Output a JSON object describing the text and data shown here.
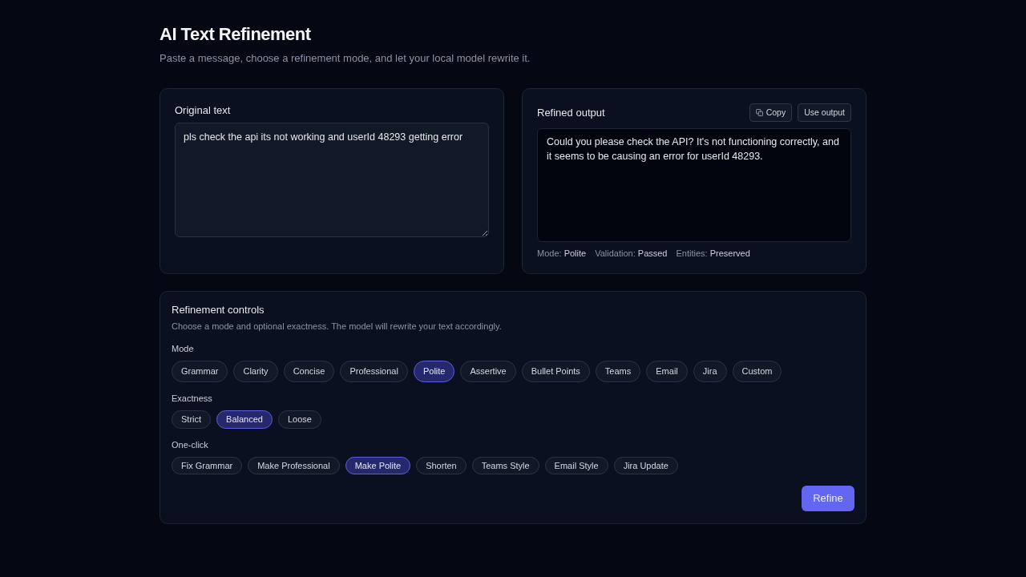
{
  "header": {
    "title": "AI Text Refinement",
    "subtitle": "Paste a message, choose a refinement mode, and let your local model rewrite it."
  },
  "original_panel": {
    "label": "Original text",
    "value": "pls check the api its not working and userId 48293 getting error"
  },
  "output_panel": {
    "label": "Refined output",
    "copy_button": {
      "label": "Copy"
    },
    "use_button": {
      "label": "Use output"
    },
    "text": "Could you please check the API? It's not functioning correctly, and it seems to be causing an error for userId 48293.",
    "meta": [
      {
        "label": "Mode:",
        "value": "Polite"
      },
      {
        "label": "Validation:",
        "value": "Passed"
      },
      {
        "label": "Entities:",
        "value": "Preserved"
      }
    ]
  },
  "controls": {
    "title": "Refinement controls",
    "description": "Choose a mode and optional exactness. The model will rewrite your text accordingly.",
    "mode": {
      "label": "Mode",
      "options": [
        {
          "label": "Grammar",
          "selected": false
        },
        {
          "label": "Clarity",
          "selected": false
        },
        {
          "label": "Concise",
          "selected": false
        },
        {
          "label": "Professional",
          "selected": false
        },
        {
          "label": "Polite",
          "selected": true
        },
        {
          "label": "Assertive",
          "selected": false
        },
        {
          "label": "Bullet Points",
          "selected": false
        },
        {
          "label": "Teams",
          "selected": false
        },
        {
          "label": "Email",
          "selected": false
        },
        {
          "label": "Jira",
          "selected": false
        },
        {
          "label": "Custom",
          "selected": false
        }
      ]
    },
    "exactness": {
      "label": "Exactness",
      "options": [
        {
          "label": "Strict",
          "selected": false
        },
        {
          "label": "Balanced",
          "selected": true
        },
        {
          "label": "Loose",
          "selected": false
        }
      ]
    },
    "one_click": {
      "label": "One-click",
      "options": [
        {
          "label": "Fix Grammar",
          "selected": false
        },
        {
          "label": "Make Professional",
          "selected": false
        },
        {
          "label": "Make Polite",
          "selected": true
        },
        {
          "label": "Shorten",
          "selected": false
        },
        {
          "label": "Teams Style",
          "selected": false
        },
        {
          "label": "Email Style",
          "selected": false
        },
        {
          "label": "Jira Update",
          "selected": false
        }
      ]
    },
    "refine_button": {
      "label": "Refine"
    }
  }
}
